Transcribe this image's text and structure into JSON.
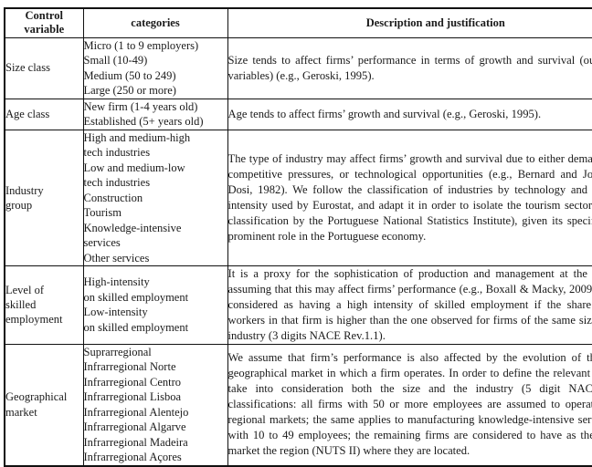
{
  "table": {
    "headers": {
      "control_variable": "Control variable",
      "control_variable_line1": "Control",
      "control_variable_line2": "variable",
      "categories": "categories",
      "description": "Description and justification"
    },
    "rows": [
      {
        "variable": "Size class",
        "variable_line1": "Size class",
        "categories": [
          "Micro (1 to 9 employers)",
          "Small (10-49)",
          "Medium (50 to 249)",
          "Large (250 or more)"
        ],
        "description": "Size tends to affect firms’ performance in terms of growth and survival (our outcome variables) (e.g., Geroski, 1995)."
      },
      {
        "variable": "Age class",
        "variable_line1": "Age class",
        "categories": [
          "New firm (1-4 years old)",
          "Established (5+ years old)"
        ],
        "description": "Age tends to affect firms’ growth and survival (e.g., Geroski, 1995)."
      },
      {
        "variable": "Industry group",
        "variable_line1": "Industry",
        "variable_line2": "group",
        "categories": [
          "High and medium-high",
          "tech industries",
          "Low and medium-low",
          "tech industries",
          "Construction",
          "Tourism",
          "Knowledge-intensive",
          "services",
          "Other services"
        ],
        "description": "The type of industry may affect firms’ growth and survival due to either demand growth, competitive pressures, or technological opportunities (e.g., Bernard and Jones, 1996; Dosi, 1982). We follow the classification of industries by technology and knowledge intensity used by Eurostat, and adapt it in order to isolate the tourism sector (using the classification by the Portuguese National Statistics Institute), given its specificities and prominent role in the Portuguese economy."
      },
      {
        "variable": "Level of skilled employment",
        "variable_line1": "Level of",
        "variable_line2": "skilled",
        "variable_line3": "employment",
        "categories": [
          "High-intensity",
          "on skilled employment",
          "Low-intensity",
          "on skilled employment"
        ],
        "description": "It is a proxy for the sophistication of production and management at the firm level, assuming that this may affect firms’ performance (e.g., Boxall & Macky, 2009). A firm is considered as having a high intensity of skilled employment if the share of skilled workers in that firm is higher than the one observed for firms of the same size class and industry (3 digits NACE Rev.1.1)."
      },
      {
        "variable": "Geographical market",
        "variable_line1": "Geographical",
        "variable_line2": "market",
        "categories": [
          "Suprarregional",
          "Infrarregional Norte",
          "Infrarregional Centro",
          "Infrarregional Lisboa",
          "Infrarregional Alentejo",
          "Infrarregional Algarve",
          "Infrarregional Madeira",
          "Infrarregional Açores"
        ],
        "description": "We assume that firm’s performance is also affected by the evolution of the relevant geographical market in which a firm operates. In order to define the relevant market we take into consideration both the size and the industry (5 digit NACE rev.1.1) classifications: all firms with 50 or more employees are assumed to operate in supra regional markets; the same applies to manufacturing knowledge-intensive services firms with 10 to 49 employees; the remaining firms are considered to have as their relevant market the region (NUTS II) where they are located."
      }
    ]
  }
}
